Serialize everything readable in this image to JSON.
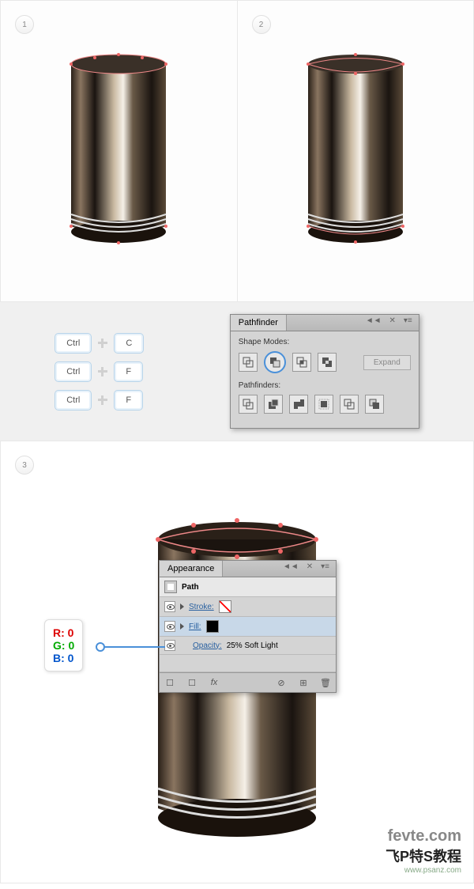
{
  "badges": {
    "b1": "1",
    "b2": "2",
    "b3": "3"
  },
  "keys": {
    "ctrl": "Ctrl",
    "c": "C",
    "f": "F"
  },
  "pathfinder": {
    "title": "Pathfinder",
    "shape_modes": "Shape Modes:",
    "pathfinders": "Pathfinders:",
    "expand": "Expand"
  },
  "appearance": {
    "title": "Appearance",
    "path": "Path",
    "stroke": "Stroke:",
    "fill": "Fill:",
    "opacity_label": "Opacity:",
    "opacity_value": "25% Soft Light"
  },
  "rgb": {
    "r": "R: 0",
    "g": "G: 0",
    "b": "B: 0"
  },
  "watermark": {
    "site": "fevte.com",
    "psanz": "www.psanz.com",
    "chinese": "飞P特S教程"
  }
}
